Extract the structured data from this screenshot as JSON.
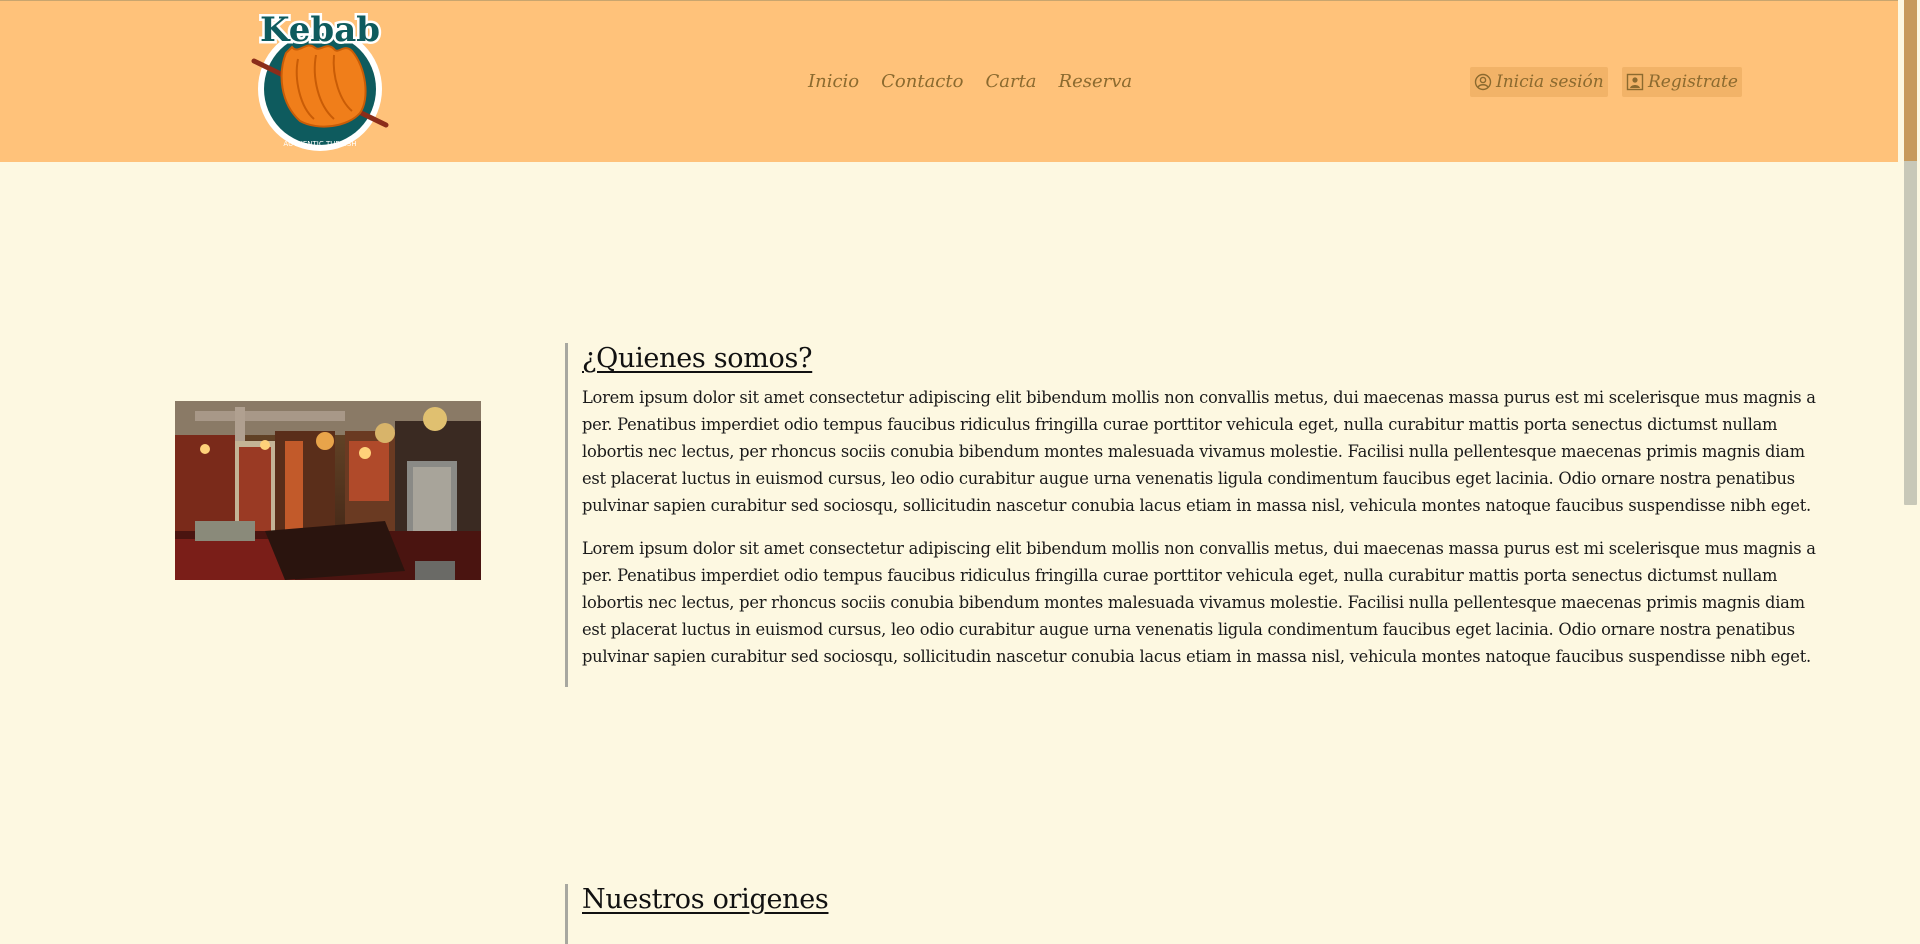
{
  "brand": {
    "logo_word": "Kebab",
    "logo_sub": "AUTHENTIC TURKISH"
  },
  "nav": {
    "items": [
      {
        "label": "Inicio"
      },
      {
        "label": "Contacto"
      },
      {
        "label": "Carta"
      },
      {
        "label": "Reserva"
      }
    ]
  },
  "auth": {
    "login_label": "Inicia sesión",
    "register_label": "Registrate"
  },
  "about": {
    "title": "¿Quienes somos?",
    "paragraphs": [
      "Lorem ipsum dolor sit amet consectetur adipiscing elit bibendum mollis non convallis metus, dui maecenas massa purus est mi scelerisque mus magnis a per. Penatibus imperdiet odio tempus faucibus ridiculus fringilla curae porttitor vehicula eget, nulla curabitur mattis porta senectus dictumst nullam lobortis nec lectus, per rhoncus sociis conubia bibendum montes malesuada vivamus molestie. Facilisi nulla pellentesque maecenas primis magnis diam est placerat luctus in euismod cursus, leo odio curabitur augue urna venenatis ligula condimentum faucibus eget lacinia. Odio ornare nostra penatibus pulvinar sapien curabitur sed sociosqu, sollicitudin nascetur conubia lacus etiam in massa nisl, vehicula montes natoque faucibus suspendisse nibh eget.",
      "Lorem ipsum dolor sit amet consectetur adipiscing elit bibendum mollis non convallis metus, dui maecenas massa purus est mi scelerisque mus magnis a per. Penatibus imperdiet odio tempus faucibus ridiculus fringilla curae porttitor vehicula eget, nulla curabitur mattis porta senectus dictumst nullam lobortis nec lectus, per rhoncus sociis conubia bibendum montes malesuada vivamus molestie. Facilisi nulla pellentesque maecenas primis magnis diam est placerat luctus in euismod cursus, leo odio curabitur augue urna venenatis ligula condimentum faucibus eget lacinia. Odio ornare nostra penatibus pulvinar sapien curabitur sed sociosqu, sollicitudin nascetur conubia lacus etiam in massa nisl, vehicula montes natoque faucibus suspendisse nibh eget."
    ]
  },
  "origins": {
    "title": "Nuestros origenes"
  },
  "colors": {
    "header_bg": "#ffc27a",
    "page_bg": "#fdf8e1",
    "nav_text": "#8b6a2f",
    "logo_teal": "#0e5b5e",
    "logo_orange": "#f07e1a"
  },
  "icons": {
    "login": "user-circle-icon",
    "register": "user-badge-icon"
  }
}
